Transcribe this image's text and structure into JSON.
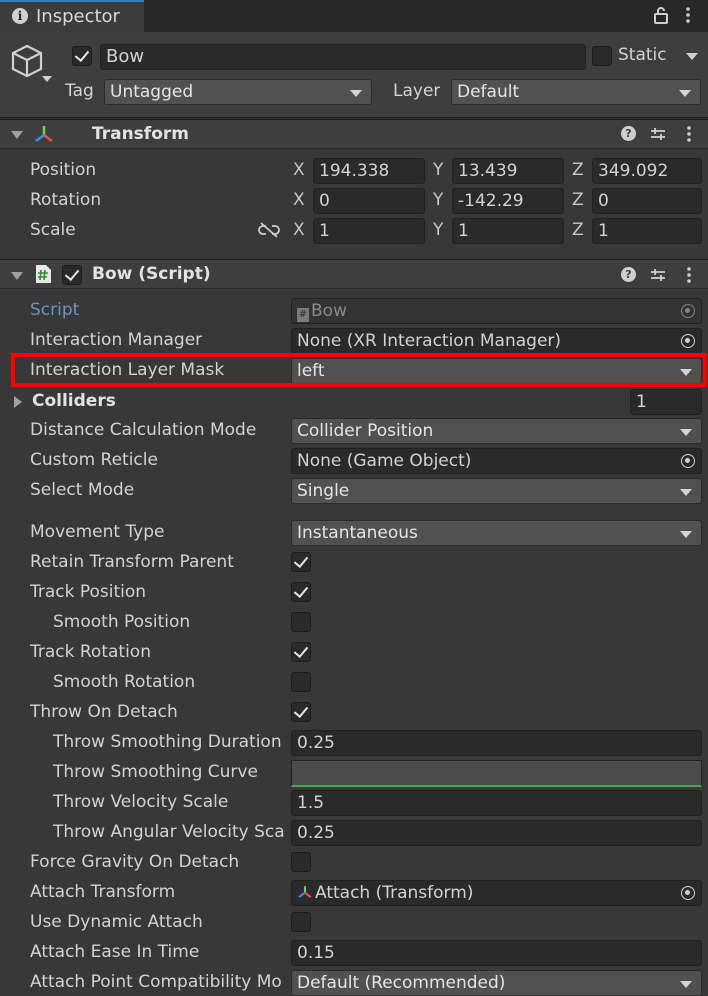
{
  "tab": {
    "title": "Inspector"
  },
  "object": {
    "name": "Bow",
    "active": true,
    "static_label": "Static",
    "tag_label": "Tag",
    "tag_value": "Untagged",
    "layer_label": "Layer",
    "layer_value": "Default"
  },
  "transform": {
    "title": "Transform",
    "position": {
      "label": "Position",
      "x": "194.338",
      "y": "13.439",
      "z": "349.092"
    },
    "rotation": {
      "label": "Rotation",
      "x": "0",
      "y": "-142.29",
      "z": "0"
    },
    "scale": {
      "label": "Scale",
      "x": "1",
      "y": "1",
      "z": "1"
    },
    "axis_x": "X",
    "axis_y": "Y",
    "axis_z": "Z"
  },
  "script": {
    "title": "Bow (Script)",
    "enabled": true,
    "rows": {
      "script": {
        "label": "Script",
        "value": "Bow"
      },
      "interaction_manager": {
        "label": "Interaction Manager",
        "value": "None (XR Interaction Manager)"
      },
      "interaction_layer_mask": {
        "label": "Interaction Layer Mask",
        "value": "left"
      },
      "colliders": {
        "label": "Colliders",
        "value": "1"
      },
      "distance_calc": {
        "label": "Distance Calculation Mode",
        "value": "Collider Position"
      },
      "custom_reticle": {
        "label": "Custom Reticle",
        "value": "None (Game Object)"
      },
      "select_mode": {
        "label": "Select Mode",
        "value": "Single"
      },
      "movement_type": {
        "label": "Movement Type",
        "value": "Instantaneous"
      },
      "retain_parent": {
        "label": "Retain Transform Parent",
        "checked": true
      },
      "track_position": {
        "label": "Track Position",
        "checked": true
      },
      "smooth_position": {
        "label": "Smooth Position",
        "checked": false
      },
      "track_rotation": {
        "label": "Track Rotation",
        "checked": true
      },
      "smooth_rotation": {
        "label": "Smooth Rotation",
        "checked": false
      },
      "throw_on_detach": {
        "label": "Throw On Detach",
        "checked": true
      },
      "throw_smoothing_duration": {
        "label": "Throw Smoothing Duration",
        "value": "0.25"
      },
      "throw_smoothing_curve": {
        "label": "Throw Smoothing Curve"
      },
      "throw_velocity_scale": {
        "label": "Throw Velocity Scale",
        "value": "1.5"
      },
      "throw_angular_velocity_scale": {
        "label": "Throw Angular Velocity Sca",
        "value": "0.25"
      },
      "force_gravity": {
        "label": "Force Gravity On Detach",
        "checked": false
      },
      "attach_transform": {
        "label": "Attach Transform",
        "value": "Attach (Transform)"
      },
      "dynamic_attach": {
        "label": "Use Dynamic Attach",
        "checked": false
      },
      "attach_ease": {
        "label": "Attach Ease In Time",
        "value": "0.15"
      },
      "attach_compat": {
        "label": "Attach Point Compatibility Mo",
        "value": "Default (Recommended)"
      }
    }
  },
  "colors": {
    "highlight": "#ff0000",
    "script_label": "#6c93c9",
    "accent_tab": "#3a79bb"
  },
  "icons": [
    "info-icon",
    "lock-icon",
    "kebab-menu-icon",
    "cube-icon",
    "transform-axes-icon",
    "help-icon",
    "preset-icon",
    "script-hash-icon",
    "unlink-icon",
    "object-picker-icon"
  ]
}
